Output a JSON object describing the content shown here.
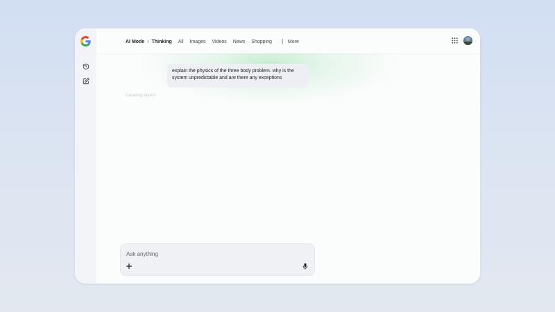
{
  "header": {
    "breadcrumb": {
      "mode": "AI Mode",
      "separator": "›",
      "current": "Thinking"
    },
    "tabs": [
      {
        "label": "All"
      },
      {
        "label": "Images"
      },
      {
        "label": "Videos"
      },
      {
        "label": "News"
      },
      {
        "label": "Shopping"
      }
    ],
    "more_label": "More",
    "more_icon": "vertical-dots-icon",
    "apps_icon": "apps-grid-icon",
    "avatar_icon": "profile-avatar"
  },
  "sidebar": {
    "logo_icon": "google-g-logo",
    "items": [
      {
        "icon": "history-icon"
      },
      {
        "icon": "new-chat-icon"
      }
    ]
  },
  "conversation": {
    "user_message": "explain the physics of the three body problem. why is the system unpredictable and are there any exceptions",
    "status_text": "Creating layout"
  },
  "composer": {
    "placeholder": "Ask anything",
    "value": "",
    "add_icon": "plus-icon",
    "mic_icon": "mic-icon"
  },
  "colors": {
    "page_background": "#d6e0f2",
    "window_background": "#fbfcfc",
    "sidebar_background": "#f2f4f8",
    "bubble_background": "#edeff4",
    "glow_accent": "#a8e6b8"
  }
}
